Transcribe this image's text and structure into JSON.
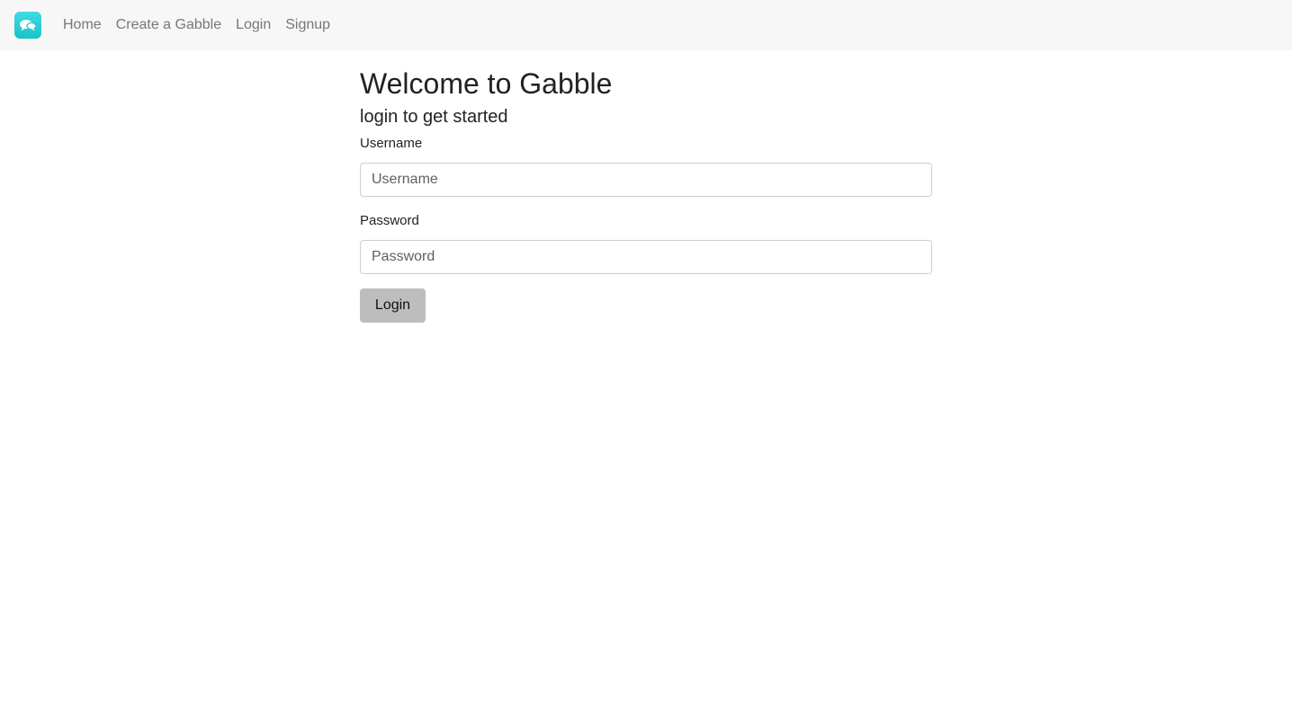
{
  "nav": {
    "brand_icon": "chat-bubbles-icon",
    "brand_color": "#1fc8cd",
    "links": [
      {
        "label": "Home"
      },
      {
        "label": "Create a Gabble"
      },
      {
        "label": "Login"
      },
      {
        "label": "Signup"
      }
    ]
  },
  "main": {
    "title": "Welcome to Gabble",
    "subtitle": "login to get started",
    "username": {
      "label": "Username",
      "placeholder": "Username",
      "value": ""
    },
    "password": {
      "label": "Password",
      "placeholder": "Password",
      "value": ""
    },
    "login_button": "Login"
  }
}
